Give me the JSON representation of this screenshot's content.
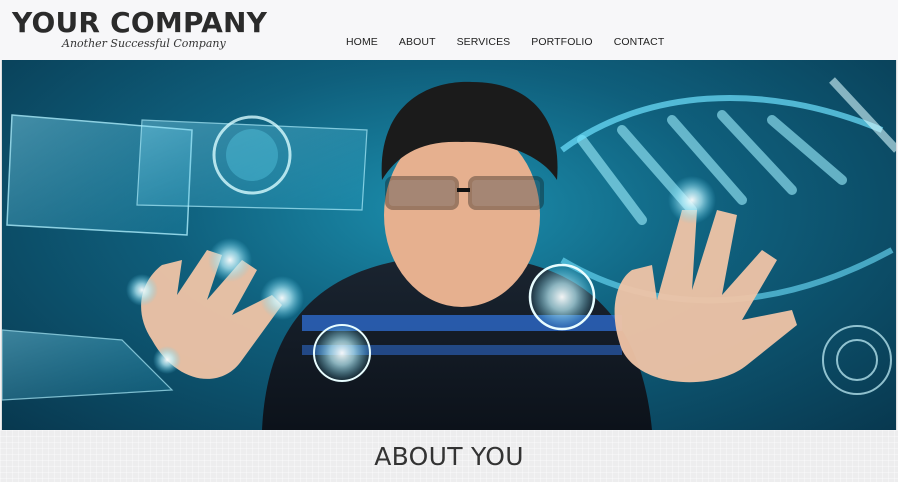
{
  "brand": {
    "name": "YOUR COMPANY",
    "tagline": "Another Successful Company"
  },
  "nav": {
    "items": [
      {
        "label": "HOME"
      },
      {
        "label": "ABOUT"
      },
      {
        "label": "SERVICES"
      },
      {
        "label": "PORTFOLIO"
      },
      {
        "label": "CONTACT"
      }
    ]
  },
  "hero": {
    "image_alt_icon": "hero-image"
  },
  "about": {
    "title": "ABOUT YOU"
  },
  "colors": {
    "header_bg": "#f7f7f9",
    "text_dark": "#2b2b2b",
    "hero_accent": "#1c8fae"
  }
}
